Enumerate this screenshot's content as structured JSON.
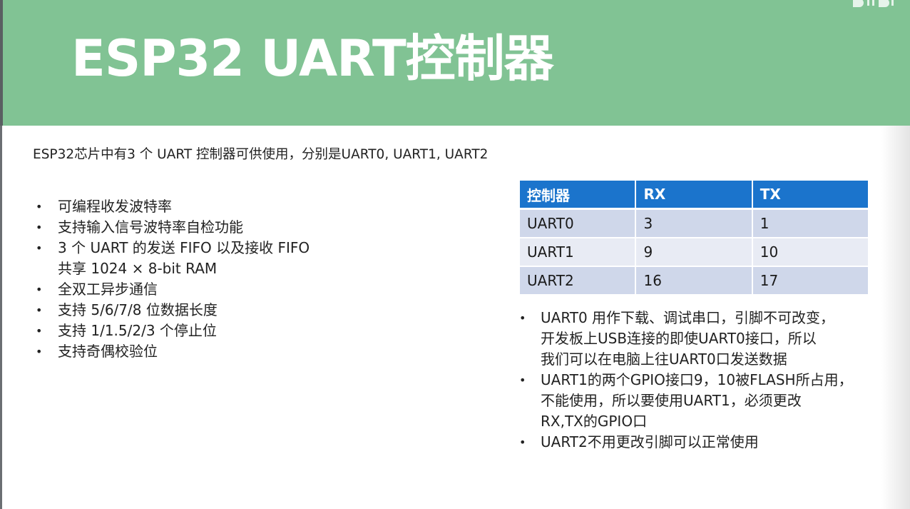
{
  "slide": {
    "title": "ESP32 UART控制器",
    "intro": "ESP32芯片中有3 个 UART 控制器可供使用，分别是UART0, UART1, UART2",
    "features": [
      "可编程收发波特率",
      "支持输入信号波特率自检功能",
      "3 个 UART 的发送 FIFO 以及接收 FIFO\n共享 1024 × 8-bit RAM",
      "全双工异步通信",
      "支持 5/6/7/8 位数据长度",
      "支持 1/1.5/2/3 个停止位",
      "支持奇偶校验位"
    ],
    "bullet_char": "•",
    "table": {
      "headers": [
        "控制器",
        "RX",
        "TX"
      ],
      "rows": [
        [
          "UART0",
          "3",
          "1"
        ],
        [
          "UART1",
          "9",
          "10"
        ],
        [
          "UART2",
          "16",
          "17"
        ]
      ]
    },
    "notes": [
      "UART0 用作下载、调试串口，引脚不可改变，\n开发板上USB连接的即使UART0接口，所以\n我们可以在电脑上往UART0口发送数据",
      "UART1的两个GPIO接口9，10被FLASH所占用，\n不能使用，所以要使用UART1，必须更改\nRX,TX的GPIO口",
      "UART2不用更改引脚可以正常使用"
    ]
  },
  "colors": {
    "title_bar": "#81c394",
    "title_text": "#ffffff",
    "table_header": "#1b74cc",
    "table_row_odd": "#cfd7ea",
    "table_row_even": "#e8ebf4"
  },
  "watermark": {
    "icon": "bilibili-logo"
  }
}
